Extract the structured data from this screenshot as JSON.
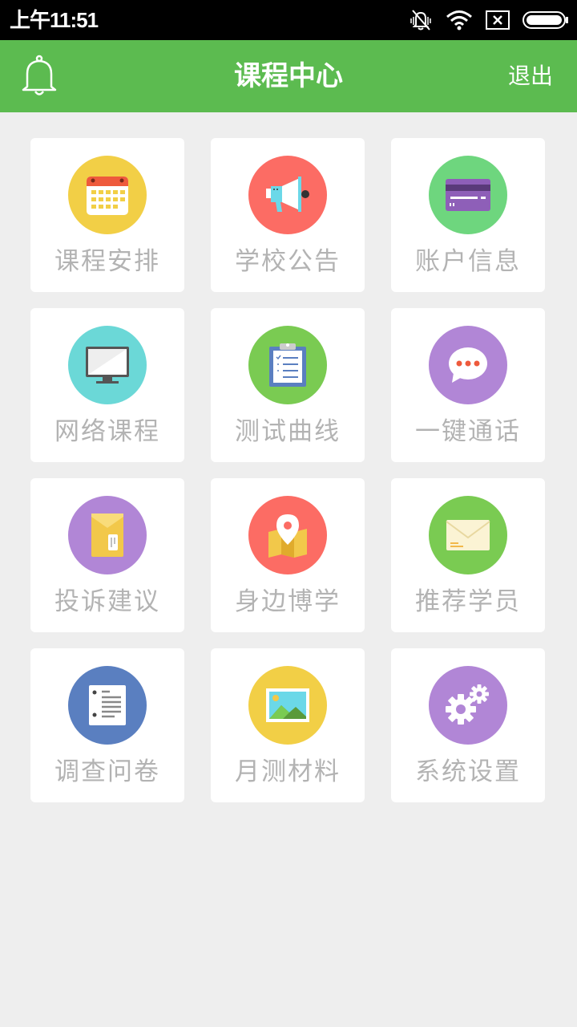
{
  "status_bar": {
    "time": "上午11:51",
    "icons": [
      "mute-icon",
      "wifi-icon",
      "no-sim-icon",
      "battery-icon"
    ]
  },
  "header": {
    "title": "课程中心",
    "logout_label": "退出",
    "bell_icon": "bell-icon"
  },
  "colors": {
    "app_bar": "#5cbb50",
    "background": "#eeeeee",
    "yellow": "#f2cf46",
    "red": "#fc6c64",
    "green": "#6ed67e",
    "cyan": "#6bd8d7",
    "leaf_green": "#7acb52",
    "purple": "#b186d6",
    "blue": "#5a7fc0"
  },
  "menu": [
    {
      "label": "课程安排",
      "icon": "calendar-icon"
    },
    {
      "label": "学校公告",
      "icon": "megaphone-icon"
    },
    {
      "label": "账户信息",
      "icon": "credit-card-icon"
    },
    {
      "label": "网络课程",
      "icon": "monitor-icon"
    },
    {
      "label": "测试曲线",
      "icon": "clipboard-icon"
    },
    {
      "label": "一键通话",
      "icon": "chat-bubble-icon"
    },
    {
      "label": "投诉建议",
      "icon": "document-envelope-icon"
    },
    {
      "label": "身边博学",
      "icon": "map-pin-icon"
    },
    {
      "label": "推荐学员",
      "icon": "mail-icon"
    },
    {
      "label": "调查问卷",
      "icon": "notebook-icon"
    },
    {
      "label": "月测材料",
      "icon": "image-icon"
    },
    {
      "label": "系统设置",
      "icon": "gears-icon"
    }
  ]
}
